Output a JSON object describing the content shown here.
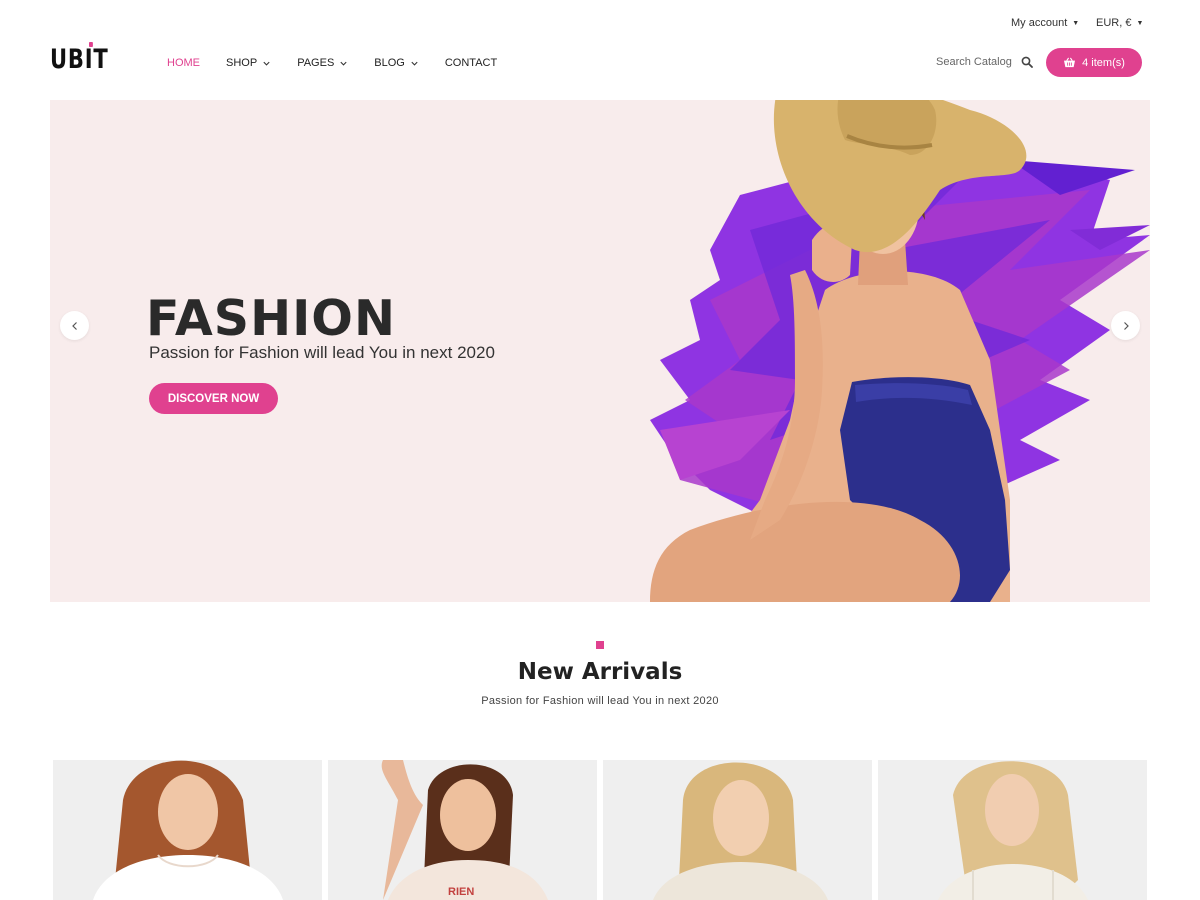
{
  "topbar": {
    "account_label": "My account",
    "currency_label": "EUR, €"
  },
  "brand": {
    "logo_text": "UBIT",
    "accent_color": "#e0418f"
  },
  "nav": {
    "items": [
      {
        "label": "HOME",
        "active": true,
        "has_dropdown": false
      },
      {
        "label": "SHOP",
        "active": false,
        "has_dropdown": true
      },
      {
        "label": "PAGES",
        "active": false,
        "has_dropdown": true
      },
      {
        "label": "BLOG",
        "active": false,
        "has_dropdown": true
      },
      {
        "label": "CONTACT",
        "active": false,
        "has_dropdown": false
      }
    ]
  },
  "search": {
    "placeholder": "Search Catalog",
    "icon": "search-icon"
  },
  "cart": {
    "label": "4 item(s)",
    "icon": "basket-icon"
  },
  "hero": {
    "title": "FASHION",
    "subtitle": "Passion for Fashion will lead You in next 2020",
    "cta_label": "DISCOVER NOW",
    "background_color": "#f8ecec",
    "prev_icon": "chevron-left-icon",
    "next_icon": "chevron-right-icon"
  },
  "new_arrivals": {
    "title": "New Arrivals",
    "subtitle": "Passion for Fashion will lead You in next 2020"
  },
  "products": [
    {
      "hair": "#a4572e",
      "shirt": "#ffffff"
    },
    {
      "hair": "#5a2f1b",
      "shirt": "#f3e6dc"
    },
    {
      "hair": "#d9b77c",
      "shirt": "#ede6da"
    },
    {
      "hair": "#dfc18c",
      "shirt": "#f2eee6"
    }
  ]
}
